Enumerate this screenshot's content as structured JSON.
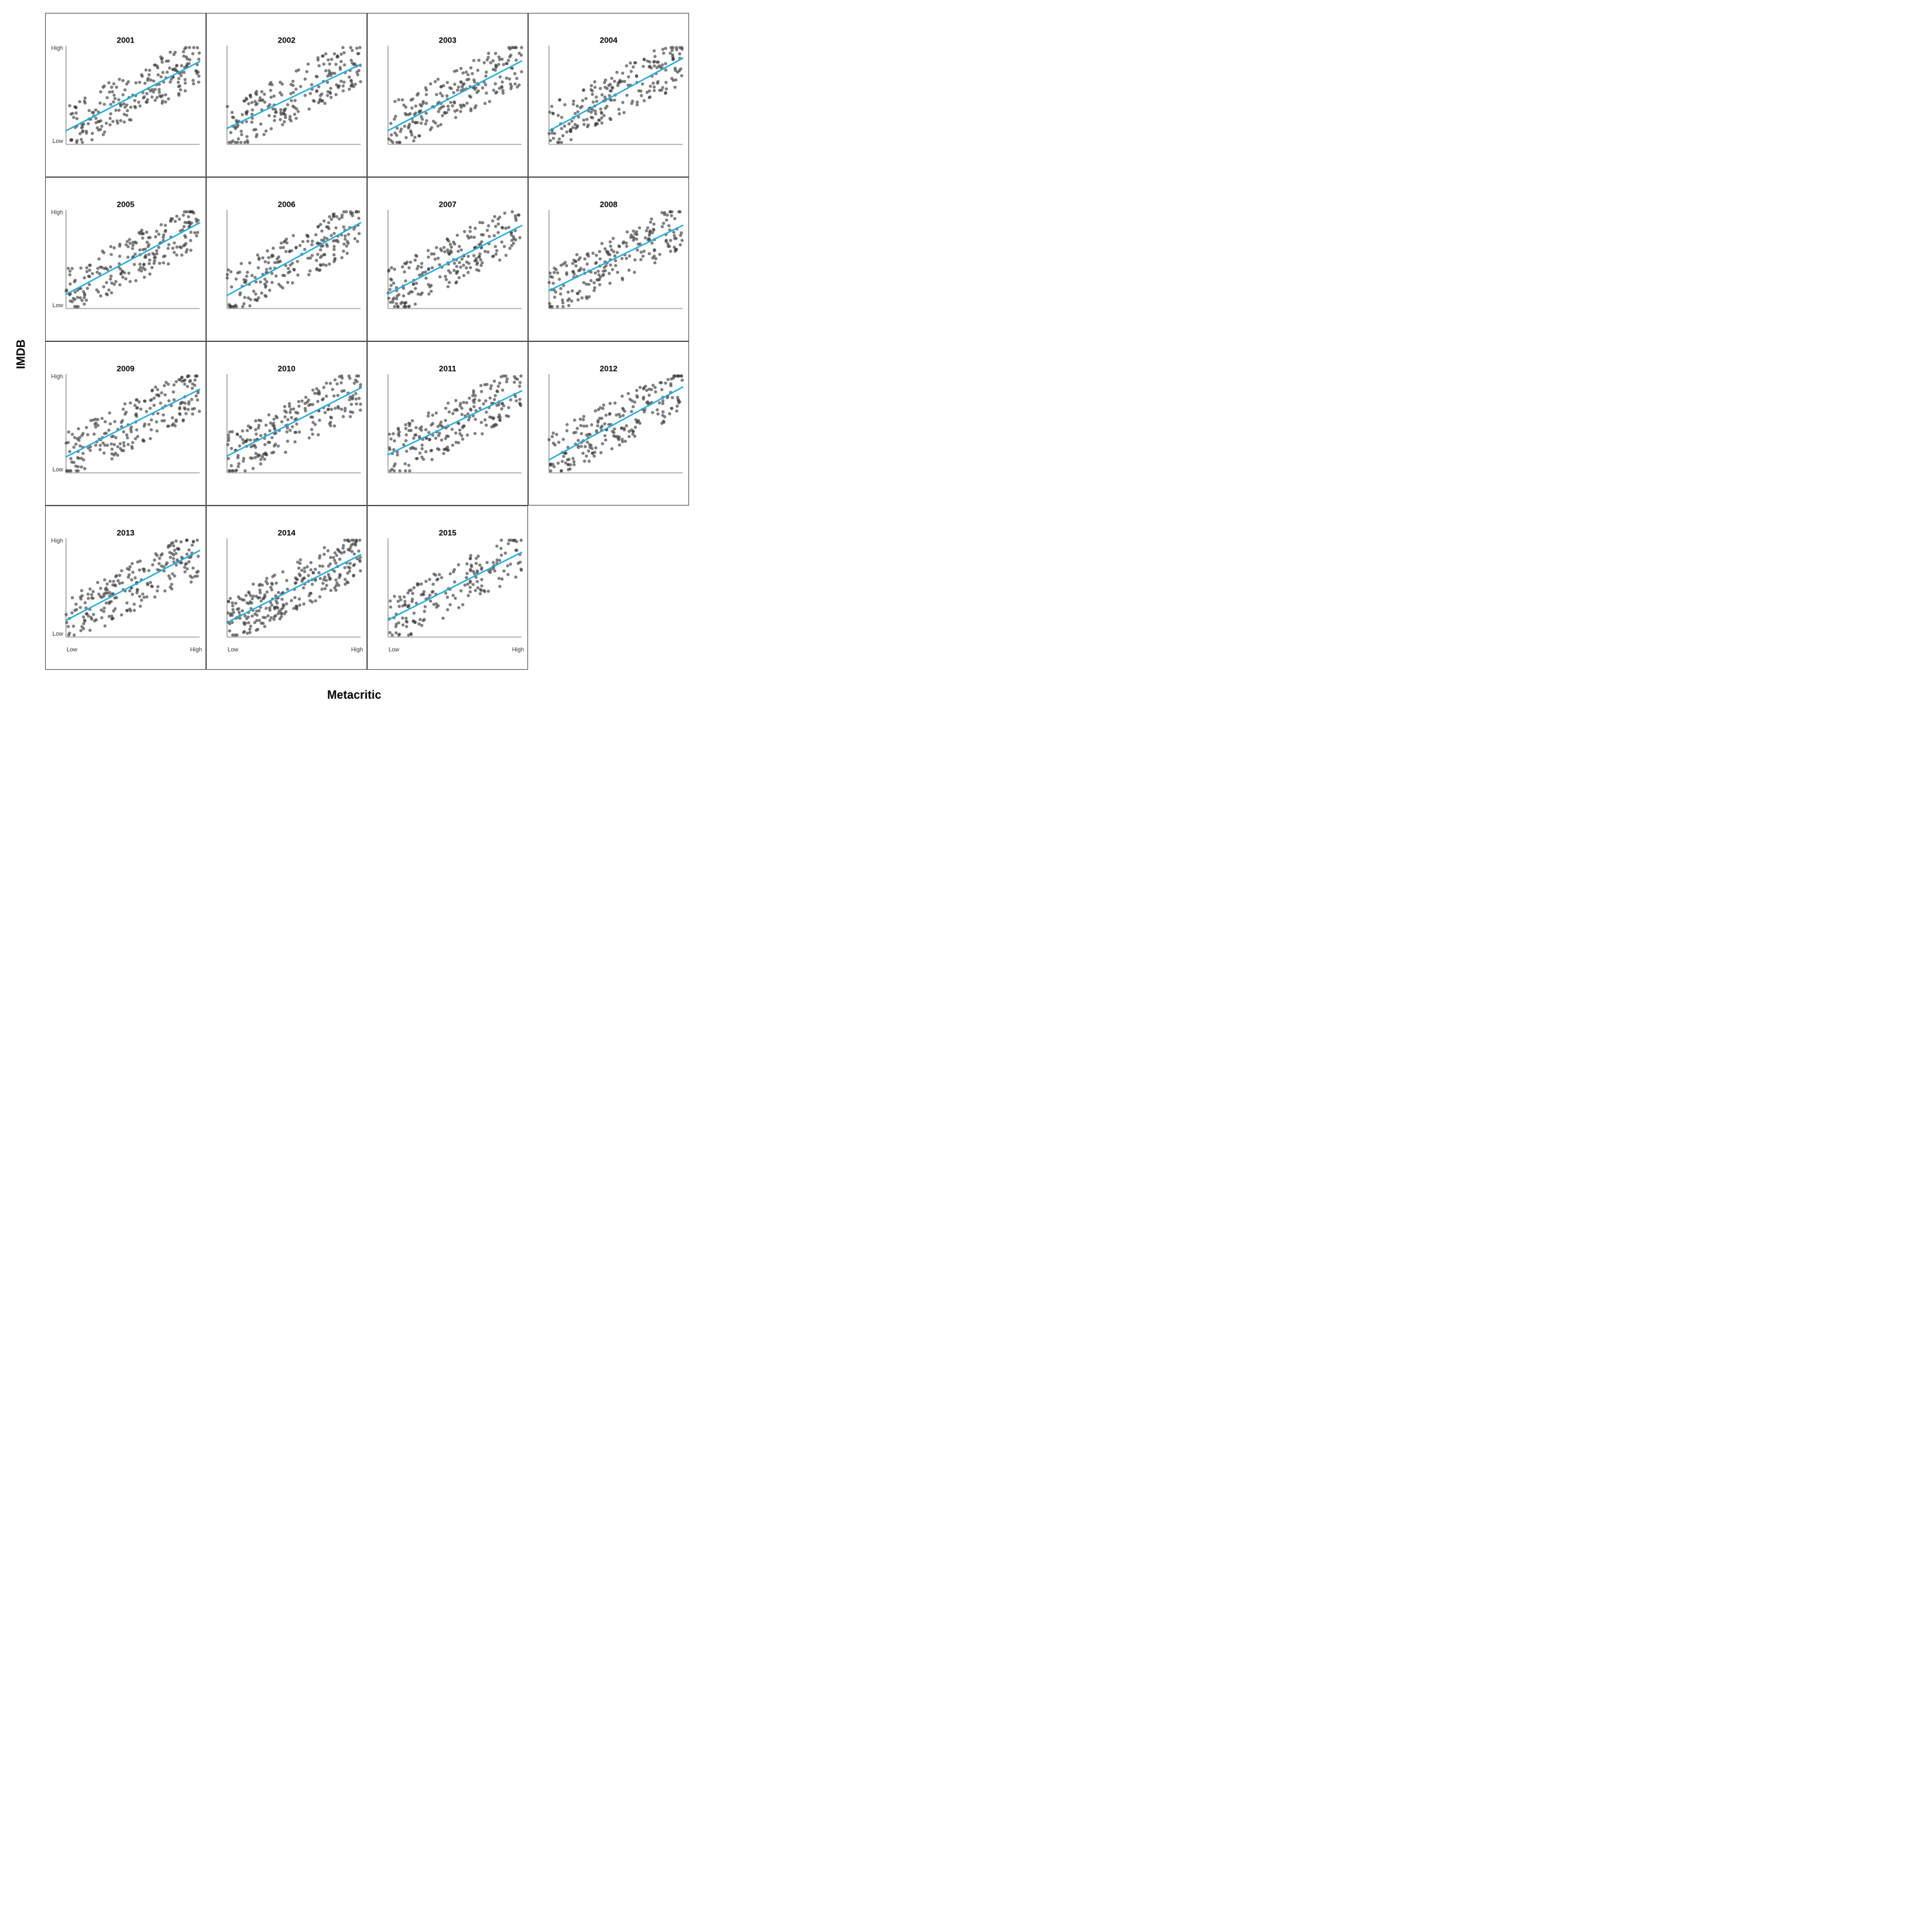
{
  "chart": {
    "title": "",
    "y_label": "IMDB",
    "x_label": "Metacritic",
    "panels": [
      {
        "year": "2001",
        "row": 0,
        "col": 0
      },
      {
        "year": "2002",
        "row": 0,
        "col": 1
      },
      {
        "year": "2003",
        "row": 0,
        "col": 2
      },
      {
        "year": "2004",
        "row": 0,
        "col": 3
      },
      {
        "year": "2005",
        "row": 1,
        "col": 0
      },
      {
        "year": "2006",
        "row": 1,
        "col": 1
      },
      {
        "year": "2007",
        "row": 1,
        "col": 2
      },
      {
        "year": "2008",
        "row": 1,
        "col": 3
      },
      {
        "year": "2009",
        "row": 2,
        "col": 0
      },
      {
        "year": "2010",
        "row": 2,
        "col": 1
      },
      {
        "year": "2011",
        "row": 2,
        "col": 2
      },
      {
        "year": "2012",
        "row": 2,
        "col": 3
      },
      {
        "year": "2013",
        "row": 3,
        "col": 0
      },
      {
        "year": "2014",
        "row": 3,
        "col": 1
      },
      {
        "year": "2015",
        "row": 3,
        "col": 2
      }
    ],
    "axis_labels": {
      "high": "High",
      "low": "Low"
    }
  }
}
